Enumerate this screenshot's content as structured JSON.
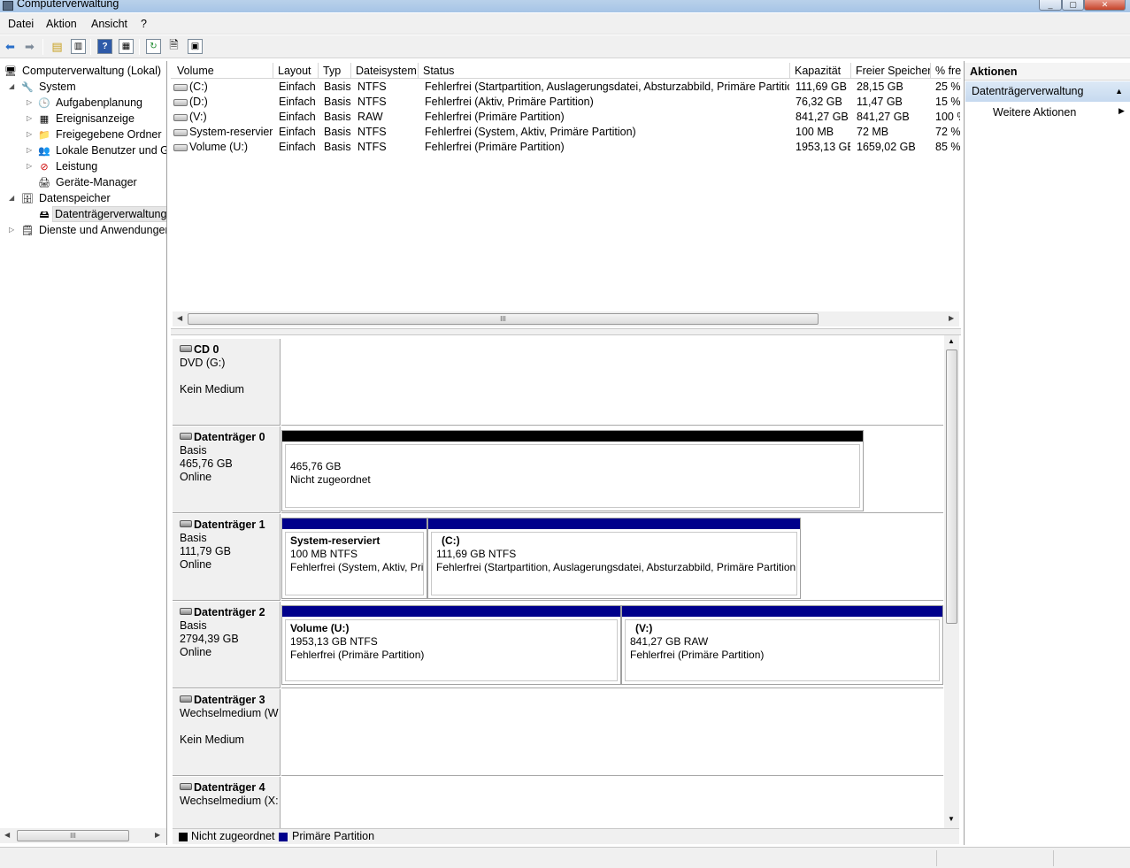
{
  "window": {
    "title": "Computerverwaltung"
  },
  "menu": [
    "Datei",
    "Aktion",
    "Ansicht",
    "?"
  ],
  "toolbar": {
    "icons": [
      "back-arrow-icon",
      "forward-arrow-icon",
      "up-folder-icon",
      "show-hide-console-tree-icon",
      "help-icon",
      "properties-pane-icon",
      "refresh-icon",
      "properties-icon",
      "disk-settings-icon"
    ]
  },
  "tree": {
    "root": "Computerverwaltung (Lokal)",
    "items": [
      {
        "label": "System",
        "level": 1,
        "expander": "expanded"
      },
      {
        "label": "Aufgabenplanung",
        "level": 2,
        "expander": "collapsed"
      },
      {
        "label": "Ereignisanzeige",
        "level": 2,
        "expander": "collapsed"
      },
      {
        "label": "Freigegebene Ordner",
        "level": 2,
        "expander": "collapsed"
      },
      {
        "label": "Lokale Benutzer und Gr",
        "level": 2,
        "expander": "collapsed"
      },
      {
        "label": "Leistung",
        "level": 2,
        "expander": "collapsed"
      },
      {
        "label": "Geräte-Manager",
        "level": 2,
        "expander": "none"
      },
      {
        "label": "Datenspeicher",
        "level": 1,
        "expander": "expanded"
      },
      {
        "label": "Datenträgerverwaltung",
        "level": 2,
        "expander": "none",
        "selected": true
      },
      {
        "label": "Dienste und Anwendungen",
        "level": 1,
        "expander": "collapsed"
      }
    ]
  },
  "volumes": {
    "columns": [
      "Volume",
      "Layout",
      "Typ",
      "Dateisystem",
      "Status",
      "Kapazität",
      "Freier Speicher",
      "% fre"
    ],
    "rows": [
      [
        "(C:)",
        "Einfach",
        "Basis",
        "NTFS",
        "Fehlerfrei (Startpartition, Auslagerungsdatei, Absturzabbild, Primäre Partition)",
        "111,69 GB",
        "28,15 GB",
        "25 %"
      ],
      [
        "(D:)",
        "Einfach",
        "Basis",
        "NTFS",
        "Fehlerfrei (Aktiv, Primäre Partition)",
        "76,32 GB",
        "11,47 GB",
        "15 %"
      ],
      [
        "(V:)",
        "Einfach",
        "Basis",
        "RAW",
        "Fehlerfrei (Primäre Partition)",
        "841,27 GB",
        "841,27 GB",
        "100 %"
      ],
      [
        "System-reserviert",
        "Einfach",
        "Basis",
        "NTFS",
        "Fehlerfrei (System, Aktiv, Primäre Partition)",
        "100 MB",
        "72 MB",
        "72 %"
      ],
      [
        "Volume (U:)",
        "Einfach",
        "Basis",
        "NTFS",
        "Fehlerfrei (Primäre Partition)",
        "1953,13 GB",
        "1659,02 GB",
        "85 %"
      ]
    ]
  },
  "disks": [
    {
      "name": "CD 0",
      "line1": "DVD (G:)",
      "line2": "",
      "line3": "Kein Medium"
    },
    {
      "name": "Datenträger 0",
      "line1": "Basis",
      "line2": "465,76 GB",
      "line3": "Online",
      "partitions": [
        {
          "title": "",
          "l1": "465,76 GB",
          "l2": "Nicht zugeordnet",
          "kind": "unallocated"
        }
      ]
    },
    {
      "name": "Datenträger 1",
      "line1": "Basis",
      "line2": "111,79 GB",
      "line3": "Online",
      "partitions": [
        {
          "title": "System-reserviert",
          "l1": "100 MB NTFS",
          "l2": "Fehlerfrei (System, Aktiv, Prir",
          "kind": "primary"
        },
        {
          "title": "(C:)",
          "l1": "111,69 GB NTFS",
          "l2": "Fehlerfrei (Startpartition, Auslagerungsdatei, Absturzabbild, Primäre Partition",
          "kind": "primary"
        }
      ]
    },
    {
      "name": "Datenträger 2",
      "line1": "Basis",
      "line2": "2794,39 GB",
      "line3": "Online",
      "partitions": [
        {
          "title": "Volume  (U:)",
          "l1": "1953,13 GB NTFS",
          "l2": "Fehlerfrei (Primäre Partition)",
          "kind": "primary"
        },
        {
          "title": "(V:)",
          "l1": "841,27 GB RAW",
          "l2": "Fehlerfrei (Primäre Partition)",
          "kind": "primary"
        }
      ]
    },
    {
      "name": "Datenträger 3",
      "line1": "Wechselmedium (W",
      "line2": "",
      "line3": "Kein Medium"
    },
    {
      "name": "Datenträger 4",
      "line1": "Wechselmedium (X:",
      "line2": "",
      "line3": ""
    }
  ],
  "legend": [
    {
      "label": "Nicht zugeordnet",
      "color": "#000000"
    },
    {
      "label": "Primäre Partition",
      "color": "#00008b"
    }
  ],
  "actions": {
    "header": "Aktionen",
    "section": "Datenträgerverwaltung",
    "item": "Weitere Aktionen"
  },
  "scroll": {
    "hthumb": "III",
    "vthumb": "III"
  }
}
